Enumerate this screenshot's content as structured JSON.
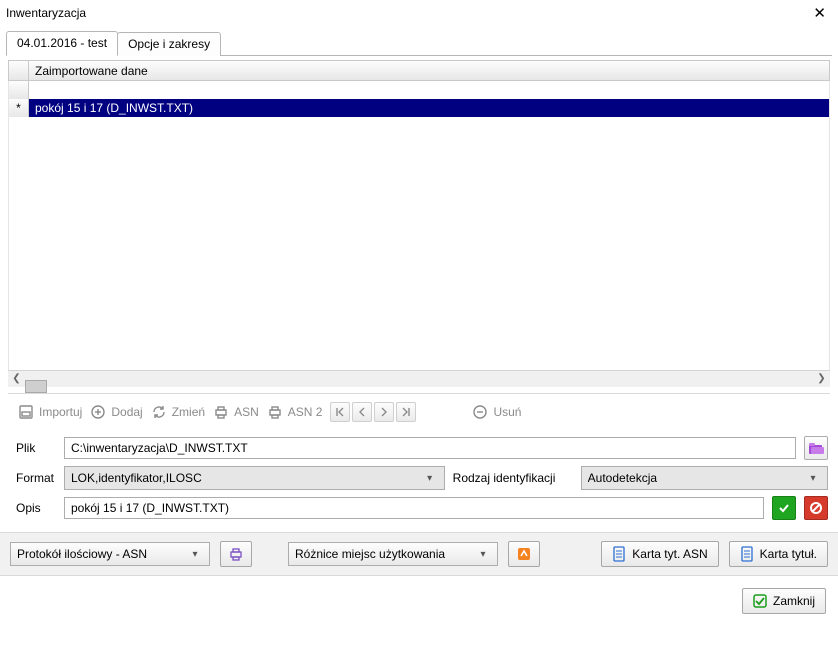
{
  "window": {
    "title": "Inwentaryzacja"
  },
  "tabs": [
    {
      "label": "04.01.2016 - test",
      "active": true
    },
    {
      "label": "Opcje i zakresy",
      "active": false
    }
  ],
  "grid": {
    "header": "Zaimportowane dane",
    "rows": [
      {
        "mark": "",
        "text": "",
        "selected": false
      },
      {
        "mark": "*",
        "text": "pokój 15 i 17 (D_INWST.TXT)",
        "selected": true
      }
    ]
  },
  "toolbar": {
    "import_label": "Importuj",
    "add_label": "Dodaj",
    "change_label": "Zmień",
    "asn_label": "ASN",
    "asn2_label": "ASN 2",
    "delete_label": "Usuń"
  },
  "form": {
    "plik": {
      "label": "Plik",
      "value": "C:\\inwentaryzacja\\D_INWST.TXT"
    },
    "format": {
      "label": "Format",
      "value": "LOK,identyfikator,ILOSC"
    },
    "rodzaj": {
      "label": "Rodzaj identyfikacji",
      "value": "Autodetekcja"
    },
    "opis": {
      "label": "Opis",
      "value": "pokój 15 i 17 (D_INWST.TXT)"
    }
  },
  "bottom": {
    "protocol_combo": "Protokół ilościowy - ASN",
    "diff_combo": "Różnice miejsc użytkowania",
    "karta_asn": "Karta tyt. ASN",
    "karta_tytul": "Karta tytuł."
  },
  "footer": {
    "close_label": "Zamknij"
  }
}
